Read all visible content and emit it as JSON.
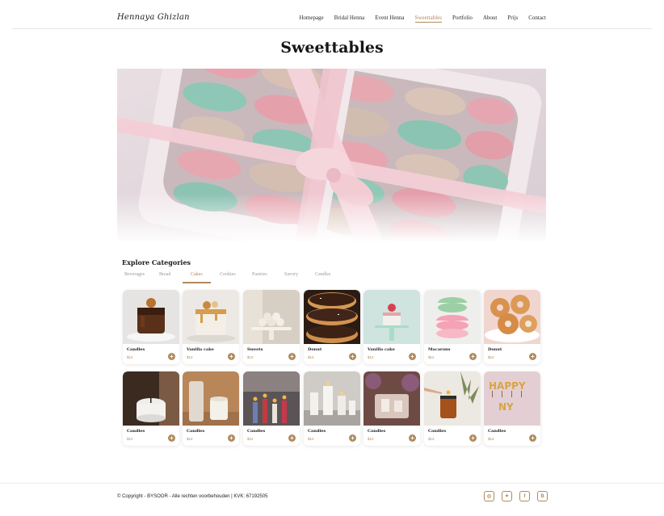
{
  "brand": {
    "logo_text": "Hennaya Ghizlan",
    "accent_color": "#b08a5d"
  },
  "nav": {
    "items": [
      {
        "label": "Homepage",
        "active": false
      },
      {
        "label": "Bridal Henna",
        "active": false
      },
      {
        "label": "Event Henna",
        "active": false
      },
      {
        "label": "Sweettables",
        "active": true
      },
      {
        "label": "Portfolio",
        "active": false
      },
      {
        "label": "About",
        "active": false
      },
      {
        "label": "Prijs",
        "active": false
      },
      {
        "label": "Contact",
        "active": false
      }
    ]
  },
  "page": {
    "title": "Sweettables",
    "hero_image": "macarons-gift-box"
  },
  "categories": {
    "title": "Explore Categories",
    "tabs": [
      {
        "label": "Beverages",
        "active": false
      },
      {
        "label": "Bread",
        "active": false
      },
      {
        "label": "Cakes",
        "active": true
      },
      {
        "label": "Cookies",
        "active": false
      },
      {
        "label": "Pastries",
        "active": false
      },
      {
        "label": "Savory",
        "active": false
      },
      {
        "label": "Candles",
        "active": false
      }
    ]
  },
  "products": {
    "row1": [
      {
        "name": "Candles",
        "price": "$12",
        "image": "chocolate-drip-cake"
      },
      {
        "name": "Vanilla cake",
        "price": "$12",
        "image": "caramel-drip-cake"
      },
      {
        "name": "Sweets",
        "price": "$12",
        "image": "truffles-on-stand"
      },
      {
        "name": "Donut",
        "price": "$12",
        "image": "chocolate-donuts"
      },
      {
        "name": "Vanilla cake",
        "price": "$12",
        "image": "mini-cake-on-stand"
      },
      {
        "name": "Macarons",
        "price": "$12",
        "image": "macaron-stack"
      },
      {
        "name": "Donut",
        "price": "$12",
        "image": "glazed-donuts"
      }
    ],
    "row2": [
      {
        "name": "Candles",
        "price": "$12",
        "image": "white-candle-jar"
      },
      {
        "name": "Candles",
        "price": "$12",
        "image": "candle-with-stone"
      },
      {
        "name": "Candles",
        "price": "$12",
        "image": "colored-candles"
      },
      {
        "name": "Candles",
        "price": "$12",
        "image": "pillar-candles"
      },
      {
        "name": "Candles",
        "price": "$12",
        "image": "candles-with-flowers"
      },
      {
        "name": "Candles",
        "price": "$12",
        "image": "amber-candle-lit"
      },
      {
        "name": "Candles",
        "price": "$12",
        "image": "happy-new-year-candles"
      }
    ],
    "add_symbol": "+"
  },
  "footer": {
    "copyright": "© Copyright - BYSOOR - Alle rechten voorbehouden | KVK: 67192505",
    "socials": [
      {
        "icon": "instagram-icon",
        "glyph": "◎"
      },
      {
        "icon": "twitter-icon",
        "glyph": "✦"
      },
      {
        "icon": "facebook-icon",
        "glyph": "f"
      },
      {
        "icon": "behance-icon",
        "glyph": "B"
      }
    ]
  }
}
